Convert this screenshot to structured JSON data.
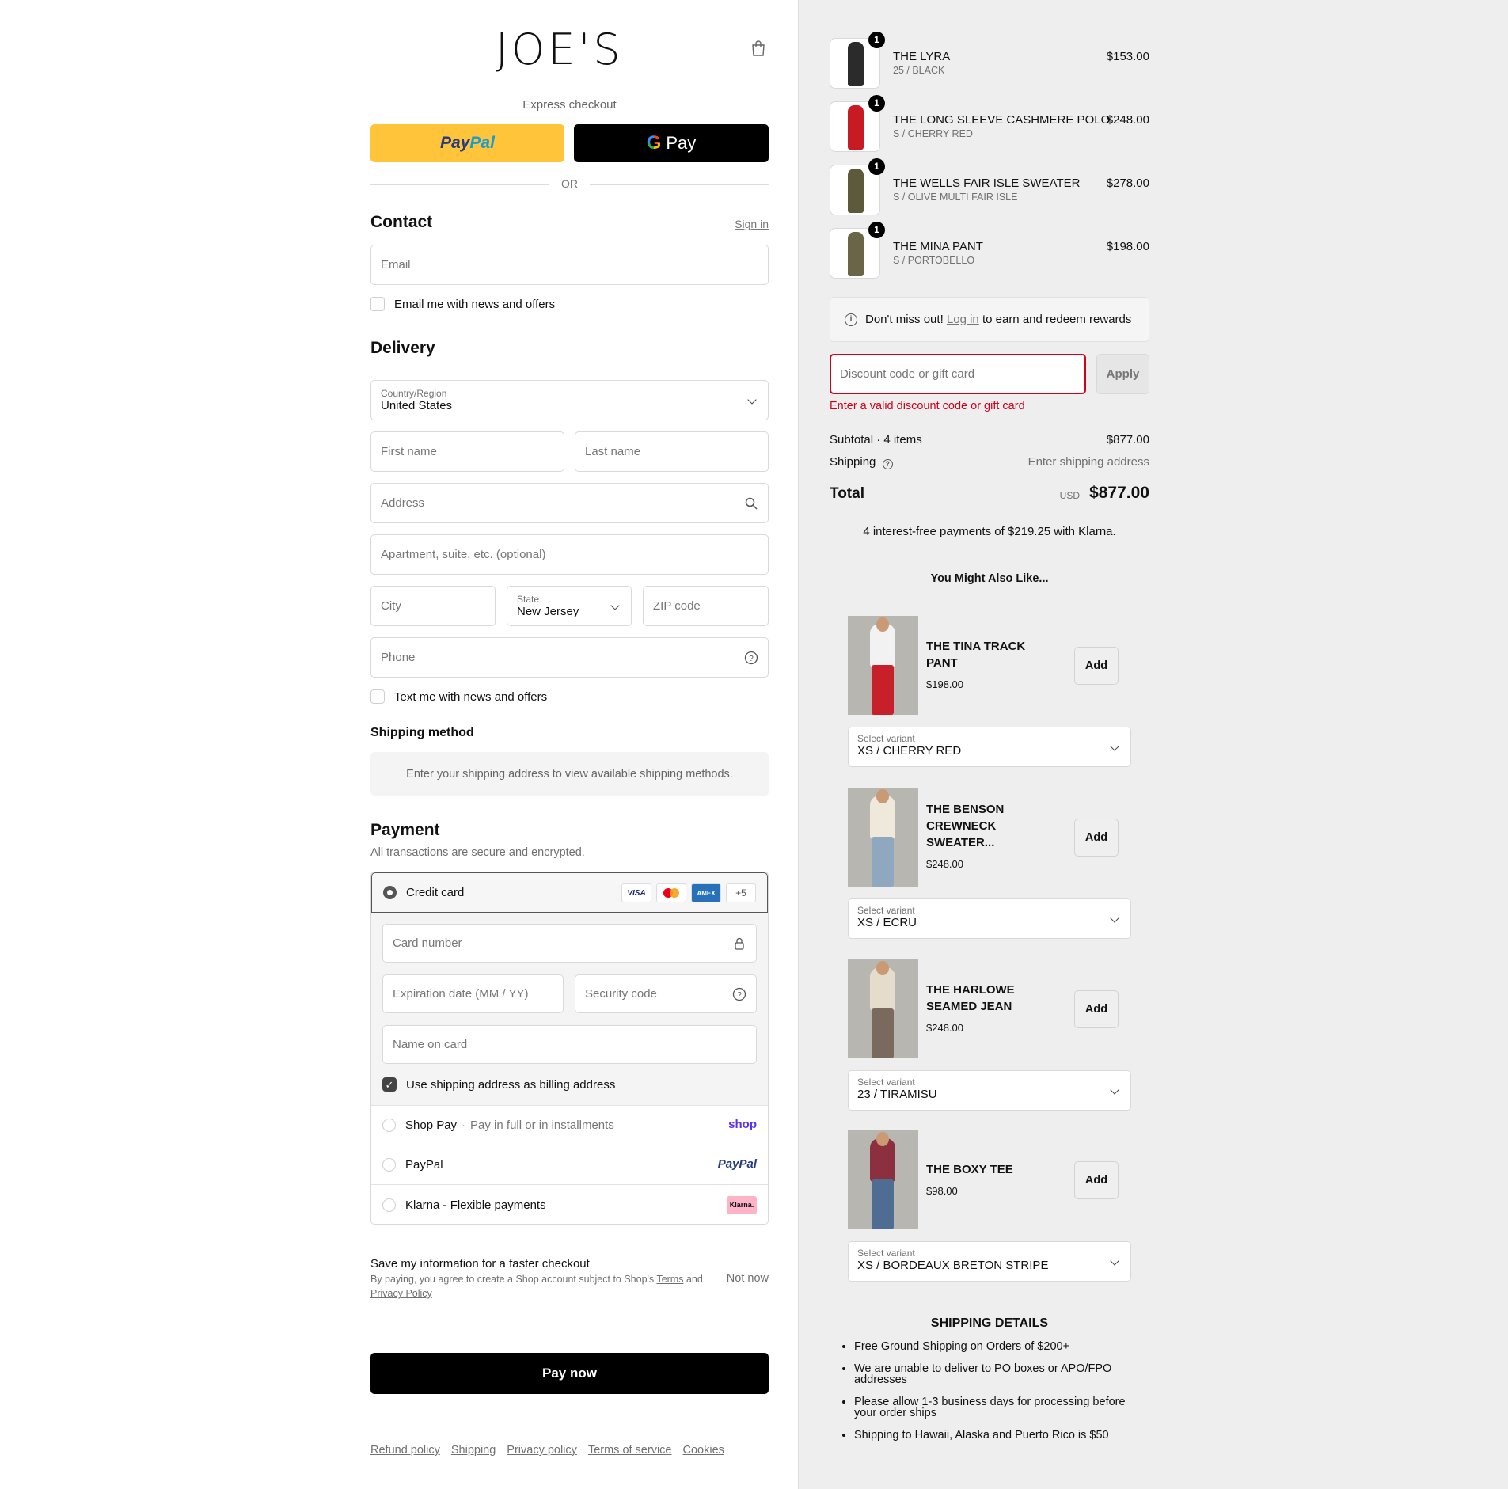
{
  "brand": {
    "logo": "JOE'S"
  },
  "express": {
    "label": "Express checkout",
    "paypal_a": "Pay",
    "paypal_b": "Pal",
    "gpay_g": "G",
    "gpay_label": "Pay",
    "or": "OR"
  },
  "contact": {
    "title": "Contact",
    "sign_in": "Sign in",
    "email_placeholder": "Email",
    "news_label": "Email me with news and offers"
  },
  "delivery": {
    "title": "Delivery",
    "country_label": "Country/Region",
    "country_value": "United States",
    "first_name": "First name",
    "last_name": "Last name",
    "address": "Address",
    "apartment": "Apartment, suite, etc. (optional)",
    "city": "City",
    "state_label": "State",
    "state_value": "New Jersey",
    "zip": "ZIP code",
    "phone": "Phone",
    "text_label": "Text me with news and offers"
  },
  "shipping_method": {
    "title": "Shipping method",
    "message": "Enter your shipping address to view available shipping methods."
  },
  "payment": {
    "title": "Payment",
    "subtitle": "All transactions are secure and encrypted.",
    "credit_card": "Credit card",
    "card_logos": [
      "VISA",
      "",
      "AMEX",
      "+5"
    ],
    "card_number": "Card number",
    "expiry": "Expiration date (MM / YY)",
    "security": "Security code",
    "name_on_card": "Name on card",
    "billing_same": "Use shipping address as billing address",
    "shop_pay": "Shop Pay",
    "shop_pay_sub": "Pay in full or in installments",
    "shop_brand": "shop",
    "paypal": "PayPal",
    "paypal_brand": "PayPal",
    "klarna": "Klarna - Flexible payments",
    "klarna_brand": "Klarna."
  },
  "save_info": {
    "title": "Save my information for a faster checkout",
    "sub_a": "By paying, you agree to create a Shop account subject to Shop's",
    "terms": "Terms",
    "and": "and",
    "privacy": "Privacy Policy",
    "not_now": "Not now"
  },
  "pay_now": "Pay now",
  "footer_links": [
    "Refund policy",
    "Shipping",
    "Privacy policy",
    "Terms of service",
    "Cookies"
  ],
  "cart": {
    "items": [
      {
        "name": "THE LYRA",
        "variant": "25 / BLACK",
        "price": "$153.00",
        "qty": "1",
        "color": "#2b2b2b"
      },
      {
        "name": "THE LONG SLEEVE CASHMERE POLO",
        "variant": "S / CHERRY RED",
        "price": "$248.00",
        "qty": "1",
        "color": "#c81a22"
      },
      {
        "name": "THE WELLS FAIR ISLE SWEATER",
        "variant": "S / OLIVE MULTI FAIR ISLE",
        "price": "$278.00",
        "qty": "1",
        "color": "#5d5a3c"
      },
      {
        "name": "THE MINA PANT",
        "variant": "S / PORTOBELLO",
        "price": "$198.00",
        "qty": "1",
        "color": "#6b6548"
      }
    ],
    "rewards_a": "Don't miss out!",
    "rewards_link": "Log in",
    "rewards_b": "to earn and redeem rewards",
    "discount_placeholder": "Discount code or gift card",
    "apply": "Apply",
    "discount_error": "Enter a valid discount code or gift card",
    "subtotal_label": "Subtotal · 4 items",
    "subtotal": "$877.00",
    "shipping_label": "Shipping",
    "shipping_value": "Enter shipping address",
    "total_label": "Total",
    "currency": "USD",
    "total": "$877.00",
    "klarna_msg": "4 interest-free payments of $219.25 with Klarna."
  },
  "upsell": {
    "title": "You Might Also Like...",
    "add_label": "Add",
    "variant_label": "Select variant",
    "products": [
      {
        "name": "THE TINA TRACK PANT",
        "price": "$198.00",
        "variant": "XS / CHERRY RED",
        "top": "#f2f2f2",
        "bottom": "#c8202a"
      },
      {
        "name": "THE BENSON CREWNECK SWEATER...",
        "price": "$248.00",
        "variant": "XS / ECRU",
        "top": "#efe9dc",
        "bottom": "#8fa7bf"
      },
      {
        "name": "THE HARLOWE SEAMED JEAN",
        "price": "$248.00",
        "variant": "23 / TIRAMISU",
        "top": "#e6dccb",
        "bottom": "#7a6a5d"
      },
      {
        "name": "THE BOXY TEE",
        "price": "$98.00",
        "variant": "XS / BORDEAUX BRETON STRIPE",
        "top": "#8c2f3f",
        "bottom": "#4f6c93"
      }
    ]
  },
  "shipping_details": {
    "title": "SHIPPING DETAILS",
    "items": [
      "Free Ground Shipping on Orders of $200+",
      "We are unable to deliver to PO boxes or APO/FPO addresses",
      "Please allow 1-3 business days for processing before your order ships",
      "Shipping to Hawaii, Alaska and Puerto Rico is $50"
    ]
  }
}
